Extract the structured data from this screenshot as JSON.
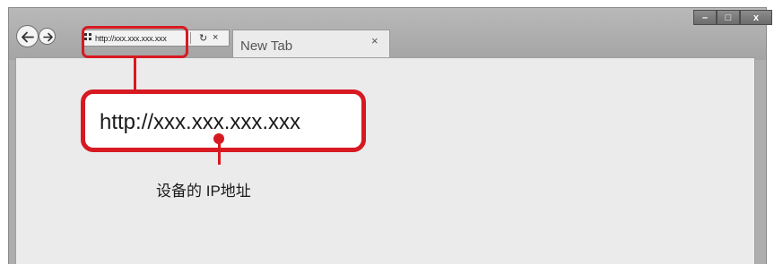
{
  "browser": {
    "address_url": "http://xxx.xxx.xxx.xxx",
    "refresh_glyph": "↻",
    "stop_glyph": "×",
    "tab_label": "New Tab",
    "tab_close_glyph": "×",
    "window_controls": {
      "minimize": "–",
      "maximize": "□",
      "close": "x"
    },
    "nav_icons": [
      "back-arrow-icon",
      "forward-arrow-icon"
    ]
  },
  "callout": {
    "url_text": "http://xxx.xxx.xxx.xxx",
    "caption": "设备的 IP地址",
    "accent_color": "#d71921"
  }
}
